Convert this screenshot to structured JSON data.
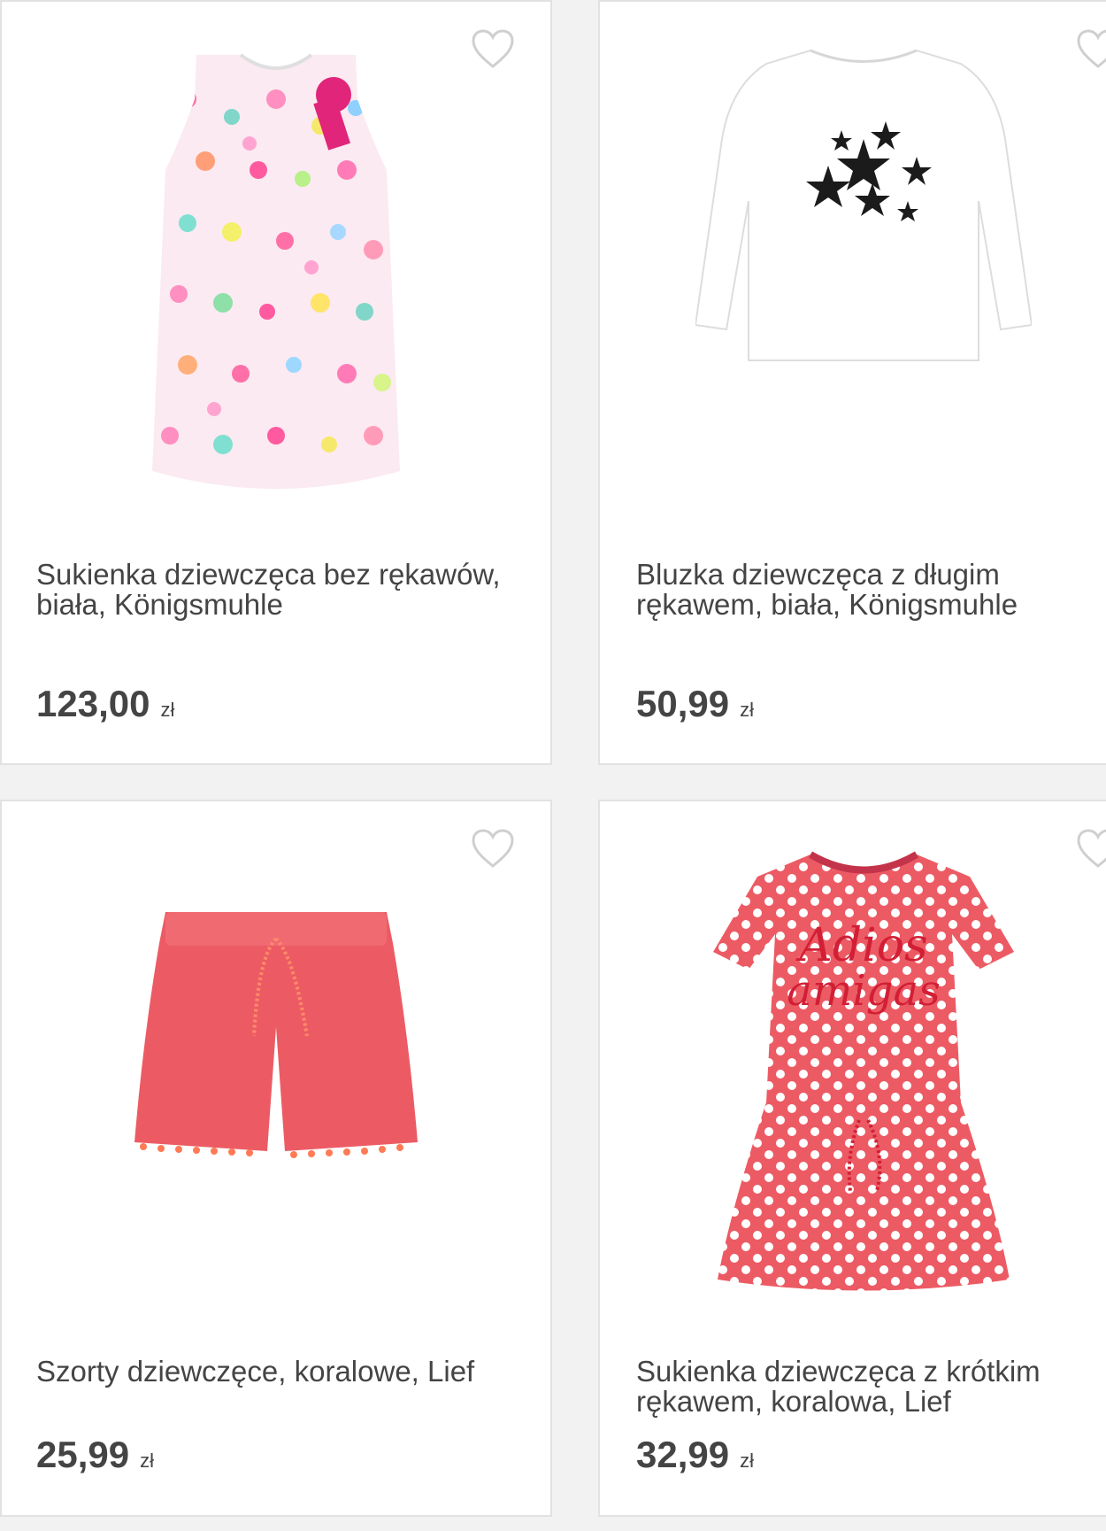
{
  "products": [
    {
      "title": "Sukienka dziewczęca bez rękawów, biała, Königsmuhle",
      "price": "123,00",
      "currency": "zł",
      "image": "floral-heart-print-dress",
      "favorite_icon": "heart-outline-icon"
    },
    {
      "title": "Bluzka dziewczęca z długim rękawem, biała, Königsmuhle",
      "price": "50,99",
      "currency": "zł",
      "image": "white-long-sleeve-star-top",
      "favorite_icon": "heart-outline-icon"
    },
    {
      "title": "Szorty dziewczęce, koralowe, Lief",
      "price": "25,99",
      "currency": "zł",
      "image": "coral-shorts",
      "favorite_icon": "heart-outline-icon"
    },
    {
      "title": "Sukienka dziewczęca z krótkim rękawem, koralowa, Lief",
      "price": "32,99",
      "currency": "zł",
      "image": "coral-polka-dot-dress",
      "favorite_icon": "heart-outline-icon"
    }
  ],
  "colors": {
    "background": "#f2f2f2",
    "card": "#ffffff",
    "text": "#444444",
    "heart_outline": "#cfcfcf",
    "coral": "#ec5b64"
  }
}
